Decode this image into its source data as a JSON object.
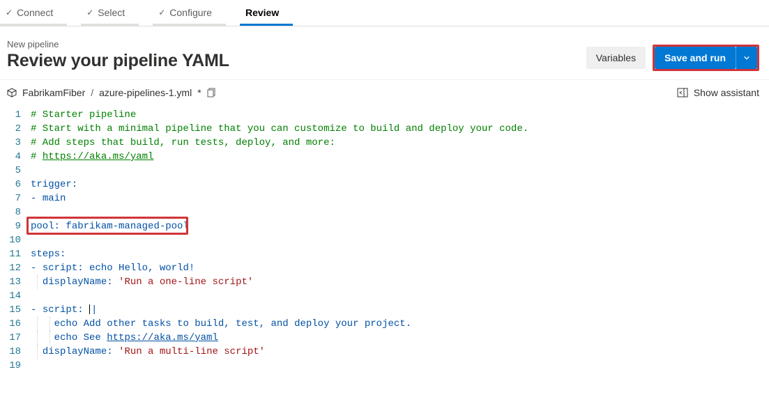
{
  "wizard": {
    "steps": [
      {
        "label": "Connect",
        "state": "done"
      },
      {
        "label": "Select",
        "state": "done"
      },
      {
        "label": "Configure",
        "state": "done"
      },
      {
        "label": "Review",
        "state": "active"
      }
    ]
  },
  "header": {
    "subtitle": "New pipeline",
    "title": "Review your pipeline YAML",
    "variables_label": "Variables",
    "save_run_label": "Save and run"
  },
  "breadcrumb": {
    "project": "FabrikamFiber",
    "separator": "/",
    "file": "azure-pipelines-1.yml",
    "dirty_marker": "*"
  },
  "assistant": {
    "label": "Show assistant"
  },
  "editor": {
    "lines": [
      {
        "n": 1,
        "segments": [
          {
            "t": "# Starter pipeline",
            "c": "c-comment"
          }
        ]
      },
      {
        "n": 2,
        "segments": [
          {
            "t": "# Start with a minimal pipeline that you can customize to build and deploy your code.",
            "c": "c-comment"
          }
        ]
      },
      {
        "n": 3,
        "segments": [
          {
            "t": "# Add steps that build, run tests, deploy, and more:",
            "c": "c-comment"
          }
        ]
      },
      {
        "n": 4,
        "segments": [
          {
            "t": "# ",
            "c": "c-comment"
          },
          {
            "t": "https://aka.ms/yaml",
            "c": "c-link"
          }
        ]
      },
      {
        "n": 5,
        "segments": []
      },
      {
        "n": 6,
        "segments": [
          {
            "t": "trigger",
            "c": "c-key"
          },
          {
            "t": ":",
            "c": "c-plain"
          }
        ]
      },
      {
        "n": 7,
        "segments": [
          {
            "t": "- ",
            "c": "c-plain"
          },
          {
            "t": "main",
            "c": "c-text"
          }
        ]
      },
      {
        "n": 8,
        "segments": []
      },
      {
        "n": 9,
        "segments": [
          {
            "t": "pool",
            "c": "c-key"
          },
          {
            "t": ": ",
            "c": "c-plain"
          },
          {
            "t": "fabrikam-managed-pool",
            "c": "c-text"
          }
        ],
        "highlighted": true
      },
      {
        "n": 10,
        "segments": []
      },
      {
        "n": 11,
        "segments": [
          {
            "t": "steps",
            "c": "c-key"
          },
          {
            "t": ":",
            "c": "c-plain"
          }
        ]
      },
      {
        "n": 12,
        "segments": [
          {
            "t": "- ",
            "c": "c-plain"
          },
          {
            "t": "script",
            "c": "c-key"
          },
          {
            "t": ": ",
            "c": "c-plain"
          },
          {
            "t": "echo Hello, world!",
            "c": "c-text"
          }
        ]
      },
      {
        "n": 13,
        "segments": [
          {
            "t": "  ",
            "c": ""
          },
          {
            "t": "displayName",
            "c": "c-key"
          },
          {
            "t": ": ",
            "c": "c-plain"
          },
          {
            "t": "'Run a one-line script'",
            "c": "c-string"
          }
        ],
        "guides": [
          1
        ]
      },
      {
        "n": 14,
        "segments": []
      },
      {
        "n": 15,
        "segments": [
          {
            "t": "- ",
            "c": "c-plain"
          },
          {
            "t": "script",
            "c": "c-key"
          },
          {
            "t": ": ",
            "c": "c-plain"
          },
          {
            "t": "|",
            "c": "c-plain",
            "cursor": true
          }
        ]
      },
      {
        "n": 16,
        "segments": [
          {
            "t": "    ",
            "c": ""
          },
          {
            "t": "echo Add other tasks to build, test, and deploy your project.",
            "c": "c-text"
          }
        ],
        "guides": [
          1,
          2
        ]
      },
      {
        "n": 17,
        "segments": [
          {
            "t": "    ",
            "c": ""
          },
          {
            "t": "echo See ",
            "c": "c-text"
          },
          {
            "t": "https://aka.ms/yaml",
            "c": "c-link2"
          }
        ],
        "guides": [
          1,
          2
        ]
      },
      {
        "n": 18,
        "segments": [
          {
            "t": "  ",
            "c": ""
          },
          {
            "t": "displayName",
            "c": "c-key"
          },
          {
            "t": ": ",
            "c": "c-plain"
          },
          {
            "t": "'Run a multi-line script'",
            "c": "c-string"
          }
        ],
        "guides": [
          1
        ]
      },
      {
        "n": 19,
        "segments": []
      }
    ]
  }
}
